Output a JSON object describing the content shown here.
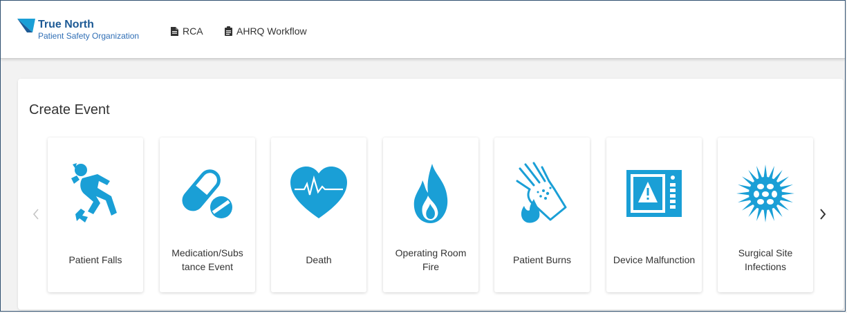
{
  "brand": {
    "name": "True North",
    "subtitle": "Patient Safety Organization",
    "color": "#1d5a95"
  },
  "nav": {
    "rca_label": "RCA",
    "workflow_label": "AHRQ Workflow"
  },
  "create_event": {
    "title": "Create Event",
    "icon_color": "#1a9fd6",
    "cards": [
      {
        "label": "Patient Falls",
        "icon": "person-falling-icon"
      },
      {
        "label": "Medication/Subs tance Event",
        "icon": "pill-icon"
      },
      {
        "label": "Death",
        "icon": "heart-heartbeat-icon"
      },
      {
        "label": "Operating Room Fire",
        "icon": "flame-icon"
      },
      {
        "label": "Patient Burns",
        "icon": "burned-hand-icon"
      },
      {
        "label": "Device Malfunction",
        "icon": "monitor-warning-icon"
      },
      {
        "label": "Surgical Site Infections",
        "icon": "virus-icon"
      }
    ]
  }
}
